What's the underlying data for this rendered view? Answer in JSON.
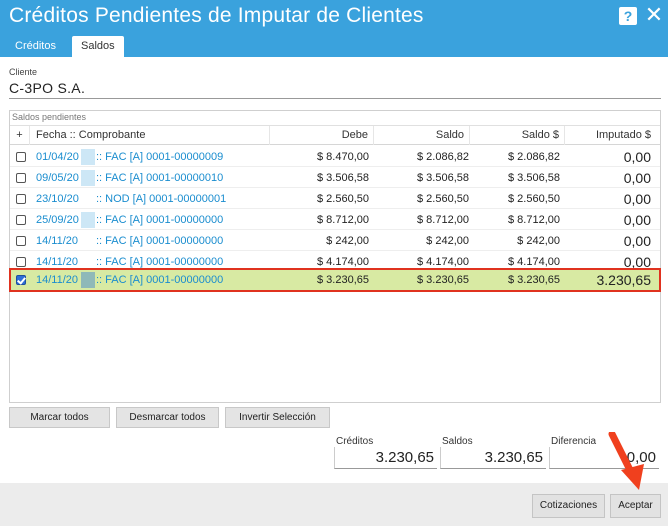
{
  "window": {
    "title": "Créditos Pendientes de Imputar de Clientes",
    "help_glyph": "?",
    "close_glyph": "✕"
  },
  "tabs": [
    {
      "label": "Créditos",
      "active": false
    },
    {
      "label": "Saldos",
      "active": true
    }
  ],
  "client": {
    "label": "Cliente",
    "value": "C-3PO S.A."
  },
  "grid": {
    "caption": "Saldos pendientes",
    "columns": {
      "check": "+",
      "comprobante": "Fecha :: Comprobante",
      "debe": "Debe",
      "saldo": "Saldo",
      "saldo_usd": "Saldo $",
      "imputado": "Imputado $"
    },
    "rows": [
      {
        "checked": false,
        "date": "01/04/20",
        "comp": ":: FAC [A] 0001-00000009",
        "debe": "$ 8.470,00",
        "saldo": "$ 2.086,82",
        "saldo_usd": "$ 2.086,82",
        "imputado": "0,00"
      },
      {
        "checked": false,
        "date": "09/05/20",
        "comp": ":: FAC [A] 0001-00000010",
        "debe": "$ 3.506,58",
        "saldo": "$ 3.506,58",
        "saldo_usd": "$ 3.506,58",
        "imputado": "0,00"
      },
      {
        "checked": false,
        "date": "23/10/20",
        "comp": ":: NOD [A] 0001-00000001",
        "debe": "$ 2.560,50",
        "saldo": "$ 2.560,50",
        "saldo_usd": "$ 2.560,50",
        "imputado": "0,00"
      },
      {
        "checked": false,
        "date": "25/09/20",
        "comp": ":: FAC [A] 0001-00000000",
        "debe": "$ 8.712,00",
        "saldo": "$ 8.712,00",
        "saldo_usd": "$ 8.712,00",
        "imputado": "0,00"
      },
      {
        "checked": false,
        "date": "14/11/20",
        "comp": ":: FAC [A] 0001-00000000",
        "debe": "$ 242,00",
        "saldo": "$ 242,00",
        "saldo_usd": "$ 242,00",
        "imputado": "0,00"
      },
      {
        "checked": false,
        "date": "14/11/20",
        "comp": ":: FAC [A] 0001-00000000",
        "debe": "$ 4.174,00",
        "saldo": "$ 4.174,00",
        "saldo_usd": "$ 4.174,00",
        "imputado": "0,00"
      },
      {
        "checked": true,
        "date": "14/11/20",
        "comp": ":: FAC [A] 0001-00000000",
        "debe": "$ 3.230,65",
        "saldo": "$ 3.230,65",
        "saldo_usd": "$ 3.230,65",
        "imputado": "3.230,65"
      }
    ]
  },
  "actions": {
    "marcar": "Marcar todos",
    "desmarcar": "Desmarcar todos",
    "invertir": "Invertir Selección"
  },
  "totals": {
    "creditos_label": "Créditos",
    "creditos_value": "3.230,65",
    "saldos_label": "Saldos",
    "saldos_value": "3.230,65",
    "diferencia_label": "Diferencia",
    "diferencia_value": "0,00"
  },
  "footer": {
    "cotizaciones": "Cotizaciones",
    "aceptar": "Aceptar"
  },
  "colors": {
    "titlebar": "#3aa2dd",
    "link": "#1a8dcf",
    "selected_row": "#d8eaa3",
    "highlight": "#e0321f",
    "arrow": "#f0401e"
  }
}
